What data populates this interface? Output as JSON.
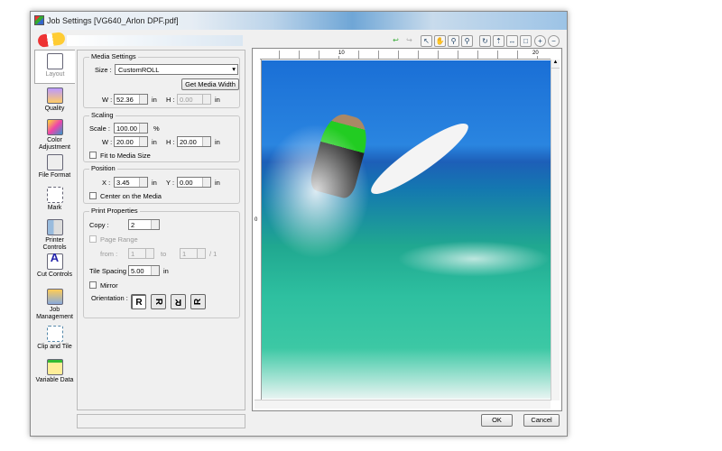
{
  "window": {
    "title": "Job Settings [VG640_Arlon DPF.pdf]"
  },
  "sidebar": {
    "items": [
      {
        "label": "Layout"
      },
      {
        "label": "Quality"
      },
      {
        "label": "Color Adjustment"
      },
      {
        "label": "File Format"
      },
      {
        "label": "Mark"
      },
      {
        "label": "Printer Controls"
      },
      {
        "label": "Cut Controls"
      },
      {
        "label": "Job Management"
      },
      {
        "label": "Clip and Tile"
      },
      {
        "label": "Variable Data"
      }
    ]
  },
  "media": {
    "title": "Media Settings",
    "size_label": "Size :",
    "size_value": "CustomROLL",
    "get_width": "Get Media Width",
    "w_label": "W :",
    "w_value": "52.36",
    "h_label": "H :",
    "h_value": "0.00",
    "unit": "in"
  },
  "scaling": {
    "title": "Scaling",
    "scale_label": "Scale :",
    "scale_value": "100.00",
    "pct": "%",
    "w_label": "W :",
    "w_value": "20.00",
    "h_label": "H :",
    "h_value": "20.00",
    "unit": "in",
    "fit_label": "Fit to Media Size"
  },
  "position": {
    "title": "Position",
    "x_label": "X :",
    "x_value": "3.45",
    "y_label": "Y :",
    "y_value": "0.00",
    "unit": "in",
    "center_label": "Center on the Media"
  },
  "print": {
    "title": "Print Properties",
    "copy_label": "Copy :",
    "copy_value": "2",
    "page_range_label": "Page Range",
    "from_label": "from :",
    "from_value": "1",
    "to_label": "to",
    "to_value": "1",
    "total": "/ 1",
    "tile_label": "Tile Spacing :",
    "tile_value": "5.00",
    "unit": "in",
    "mirror_label": "Mirror",
    "orientation_label": "Orientation :",
    "orientations": [
      "R",
      "R",
      "R",
      "R"
    ]
  },
  "preview": {
    "ruler_top": [
      "10",
      "20"
    ],
    "ruler_left": [
      "0"
    ]
  },
  "footer": {
    "ok": "OK",
    "cancel": "Cancel"
  }
}
